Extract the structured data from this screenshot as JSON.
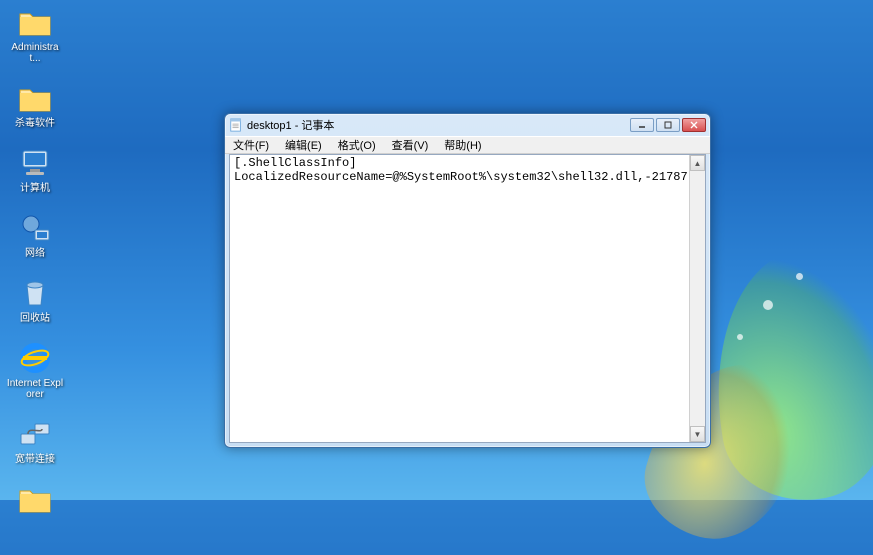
{
  "desktop": {
    "icons": [
      {
        "name": "administrator",
        "label": "Administrat...",
        "glyph": "folder-user"
      },
      {
        "name": "antivirus",
        "label": "杀毒软件",
        "glyph": "folder"
      },
      {
        "name": "computer",
        "label": "计算机",
        "glyph": "computer"
      },
      {
        "name": "network",
        "label": "网络",
        "glyph": "network"
      },
      {
        "name": "recyclebin",
        "label": "回收站",
        "glyph": "recyclebin"
      },
      {
        "name": "ie",
        "label": "Internet Explorer",
        "glyph": "ie"
      },
      {
        "name": "broadband",
        "label": "宽带连接",
        "glyph": "broadband"
      },
      {
        "name": "folder8",
        "label": "",
        "glyph": "folder"
      }
    ]
  },
  "window": {
    "title": "desktop1 - 记事本",
    "menu": {
      "file": "文件(F)",
      "edit": "编辑(E)",
      "format": "格式(O)",
      "view": "查看(V)",
      "help": "帮助(H)"
    },
    "content": "[.ShellClassInfo]\nLocalizedResourceName=@%SystemRoot%\\system32\\shell32.dll,-21787"
  }
}
